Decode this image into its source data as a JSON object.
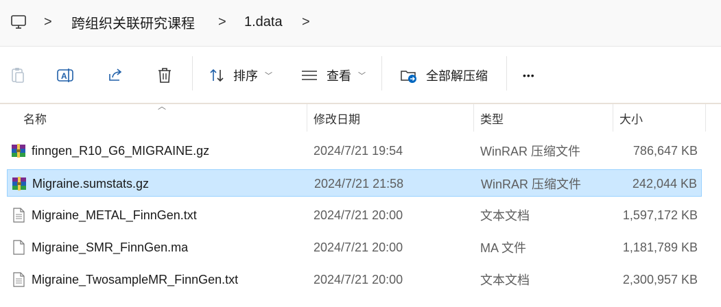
{
  "address": {
    "computer_icon": "computer-icon",
    "separator": ">",
    "crumbs": [
      "跨组织关联研究课程",
      "1.data"
    ]
  },
  "toolbar": {
    "sort_label": "排序",
    "view_label": "查看",
    "extract_label": "全部解压缩",
    "more_label": "•••"
  },
  "columns": {
    "name": "名称",
    "date": "修改日期",
    "type": "类型",
    "size": "大小"
  },
  "files": [
    {
      "name": "finngen_R10_G6_MIGRAINE.gz",
      "date": "2024/7/21 19:54",
      "type": "WinRAR 压缩文件",
      "size": "786,647 KB",
      "icon": "winrar-icon",
      "selected": false
    },
    {
      "name": "Migraine.sumstats.gz",
      "date": "2024/7/21 21:58",
      "type": "WinRAR 压缩文件",
      "size": "242,044 KB",
      "icon": "winrar-icon",
      "selected": true
    },
    {
      "name": "Migraine_METAL_FinnGen.txt",
      "date": "2024/7/21 20:00",
      "type": "文本文档",
      "size": "1,597,172 KB",
      "icon": "text-file-icon",
      "selected": false
    },
    {
      "name": "Migraine_SMR_FinnGen.ma",
      "date": "2024/7/21 20:00",
      "type": "MA 文件",
      "size": "1,181,789 KB",
      "icon": "blank-file-icon",
      "selected": false
    },
    {
      "name": "Migraine_TwosampleMR_FinnGen.txt",
      "date": "2024/7/21 20:00",
      "type": "文本文档",
      "size": "2,300,957 KB",
      "icon": "text-file-icon",
      "selected": false
    }
  ],
  "colors": {
    "selection_bg": "#cce8ff",
    "selection_border": "#99d1ff",
    "accent": "#0067c0"
  }
}
